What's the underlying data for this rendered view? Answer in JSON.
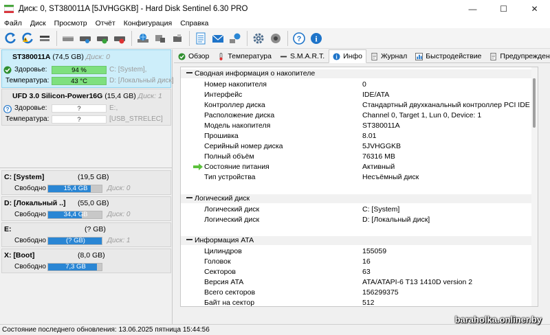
{
  "window": {
    "title": "Диск: 0, ST380011A [5JVHGGKB]  -  Hard Disk Sentinel 6.30 PRO",
    "minimize": "—",
    "maximize": "☐",
    "close": "✕"
  },
  "menu": [
    "Файл",
    "Диск",
    "Просмотр",
    "Отчёт",
    "Конфигурация",
    "Справка"
  ],
  "left_panel": {
    "disks": [
      {
        "name": "ST380011A",
        "size": "(74,5 GB)",
        "disk_label": "Диск: 0",
        "health_label": "Здоровье:",
        "health_value": "94 %",
        "temp_label": "Температура:",
        "temp_value": "43 °C",
        "vol1": "C: [System],",
        "vol2": "D: [Локальный диск]"
      },
      {
        "name": "UFD 3.0 Silicon-Power16G",
        "size": "(15,4 GB)",
        "disk_label": "Диск: 1",
        "health_label": "Здоровье:",
        "health_value": "?",
        "temp_label": "Температура:",
        "temp_value": "?",
        "vol1": "E:,",
        "vol2": "[USB_STRELEC]"
      }
    ],
    "volumes": [
      {
        "name": "C: [System]",
        "size": "(19,5 GB)",
        "free_label": "Свободно",
        "free": "15,4 GB",
        "free_fraction": 0.79,
        "disk": "Диск: 0"
      },
      {
        "name": "D: [Локальный ..]",
        "size": "(55,0 GB)",
        "free_label": "Свободно",
        "free": "34,4 GB",
        "free_fraction": 0.63,
        "disk": "Диск: 0"
      },
      {
        "name": "E:",
        "size": "(? GB)",
        "free_label": "Свободно",
        "free": "(? GB)",
        "free_fraction": 1.0,
        "disk": "Диск: 1"
      },
      {
        "name": "X: [Boot]",
        "size": "(8,0 GB)",
        "free_label": "Свободно",
        "free": "7,3 GB",
        "free_fraction": 0.91,
        "disk": ""
      }
    ]
  },
  "tabs": [
    {
      "label": "Обзор",
      "icon": "check-icon"
    },
    {
      "label": "Температура",
      "icon": "thermometer-icon"
    },
    {
      "label": "S.M.A.R.T.",
      "icon": "minus-icon"
    },
    {
      "label": "Инфо",
      "icon": "info-icon",
      "active": true
    },
    {
      "label": "Журнал",
      "icon": "document-icon"
    },
    {
      "label": "Быстродействие",
      "icon": "chart-icon"
    },
    {
      "label": "Предупреждения",
      "icon": "document-icon"
    }
  ],
  "info": {
    "summary_title": "Сводная информация о накопителе",
    "summary": [
      {
        "label": "Номер накопителя",
        "value": "0"
      },
      {
        "label": "Интерфейс",
        "value": "IDE/ATA"
      },
      {
        "label": "Контроллер диска",
        "value": "Стандартный двухканальный контроллер PCI IDE (ATA)"
      },
      {
        "label": "Расположение диска",
        "value": "Channel 0, Target 1, Lun 0, Device: 1"
      },
      {
        "label": "Модель накопителя",
        "value": "ST380011A"
      },
      {
        "label": "Прошивка",
        "value": "8.01"
      },
      {
        "label": "Серийный номер диска",
        "value": "5JVHGGKB"
      },
      {
        "label": "Полный объём",
        "value": "76316 MB"
      },
      {
        "label": "Состояние питания",
        "value": "Активный"
      },
      {
        "label": "Тип устройства",
        "value": "Несъёмный диск"
      }
    ],
    "logical_title": "Логический диск",
    "logical": [
      {
        "label": "Логический диск",
        "value": "C: [System]"
      },
      {
        "label": "Логический диск",
        "value": "D: [Локальный диск]"
      }
    ],
    "ata_title": "Информация ATA",
    "ata": [
      {
        "label": "Цилиндров",
        "value": "155059"
      },
      {
        "label": "Головок",
        "value": "16"
      },
      {
        "label": "Секторов",
        "value": "63"
      },
      {
        "label": "Версия ATA",
        "value": "ATA/ATAPI-6 T13 1410D version 2"
      },
      {
        "label": "Всего секторов",
        "value": "156299375"
      },
      {
        "label": "Байт на сектор",
        "value": "512"
      }
    ]
  },
  "status": {
    "text": "Состояние последнего обновления: 13.06.2025 пятница 15:44:56",
    "watermark": "baraholka.onliner.by"
  },
  "colors": {
    "selected_card": "#cdeefa",
    "health_green": "#7ee07e",
    "free_bar_blue": "#2a86d4",
    "accent_blue": "#1a6fc7"
  }
}
